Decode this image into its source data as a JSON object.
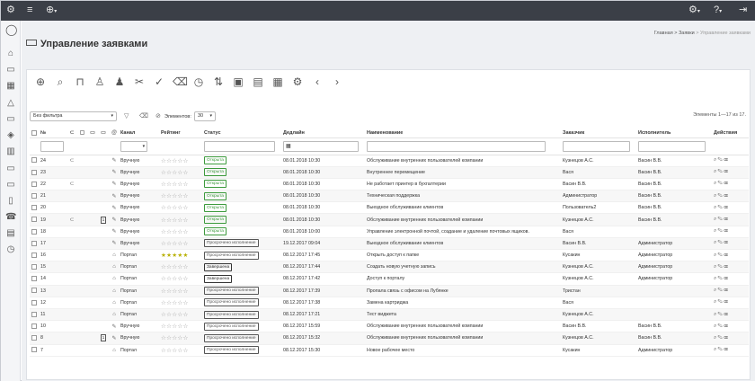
{
  "topbar": {
    "logo_icon": "gear-logo-icon",
    "menu_icon": "hamburger-icon",
    "add_icon": "plus-circle-icon",
    "right_icons": [
      "settings-icon",
      "help-icon",
      "logout-icon"
    ]
  },
  "sidebar": {
    "items": [
      "user-icon",
      "home-icon",
      "ticket-icon",
      "calendar-icon",
      "warning-icon",
      "box-icon",
      "layers-icon",
      "chart-icon",
      "monitor-icon",
      "laptop-icon",
      "phone-icon",
      "call-icon",
      "database-icon",
      "history-icon"
    ]
  },
  "header": {
    "title": "Управление заявками",
    "breadcrumb": {
      "home": "Главная",
      "sep1": "> Заявки",
      "current": "> Управление заявками"
    }
  },
  "toolbar": {
    "icons": [
      "add-icon",
      "search-icon",
      "bookmark-icon",
      "user-icon",
      "users-icon",
      "tools-icon",
      "check-icon",
      "trash-icon",
      "timer-icon",
      "sort-icon",
      "export-icon",
      "list-icon",
      "report-icon",
      "settings-icon",
      "prev-icon",
      "next-icon"
    ]
  },
  "filters": {
    "filter_select": "Без фильтра",
    "elements_label": "Элементов:",
    "page_size": "30",
    "count_text": "Элементы 1—17 из 17."
  },
  "table": {
    "headers": {
      "num": "№",
      "channel": "Канал",
      "rating": "Рейтинг",
      "status": "Статус",
      "deadline": "Дедлайн",
      "name": "Наименование",
      "customer": "Заказчик",
      "executor": "Исполнитель",
      "actions": "Действия"
    },
    "rows": [
      {
        "num": "24",
        "clip": true,
        "edit": "pencil",
        "channel": "Вручную",
        "stars": "☆☆☆☆☆",
        "gold": false,
        "status": "Открыта",
        "st": "open",
        "deadline": "08.01.2018 10:30",
        "name": "Обслуживание внутренних пользователей компании",
        "customer": "Кузнецов А.С.",
        "executor": "Васин В.В."
      },
      {
        "num": "23",
        "edit": "pencil",
        "channel": "Вручную",
        "stars": "☆☆☆☆☆",
        "gold": false,
        "status": "Открыта",
        "st": "open",
        "deadline": "08.01.2018 10:30",
        "name": "Внутреннее перемещение",
        "customer": "Вася",
        "executor": "Васин В.В."
      },
      {
        "num": "22",
        "clip": true,
        "edit": "pencil",
        "channel": "Вручную",
        "stars": "☆☆☆☆☆",
        "gold": false,
        "status": "Открыта",
        "st": "open",
        "deadline": "08.01.2018 10:30",
        "name": "Не работает принтер в бухгалтерии",
        "customer": "Васин В.В.",
        "executor": "Васин В.В."
      },
      {
        "num": "21",
        "edit": "pencil",
        "channel": "Вручную",
        "stars": "☆☆☆☆☆",
        "gold": false,
        "status": "Открыта",
        "st": "open",
        "deadline": "08.01.2018 10:30",
        "name": "Техническая поддержка",
        "customer": "Администратор",
        "executor": "Васин В.В."
      },
      {
        "num": "20",
        "edit": "pencil",
        "channel": "Вручную",
        "stars": "☆☆☆☆☆",
        "gold": false,
        "status": "Открыта",
        "st": "open",
        "deadline": "08.01.2018 10:30",
        "name": "Выездное обслуживание клиентов",
        "customer": "Пользователь2",
        "executor": "Васин В.В."
      },
      {
        "num": "19",
        "clip": true,
        "box": "1",
        "edit": "pencil",
        "channel": "Вручную",
        "stars": "☆☆☆☆☆",
        "gold": false,
        "status": "Открыта",
        "st": "open",
        "deadline": "08.01.2018 10:30",
        "name": "Обслуживание внутренних пользователей компании",
        "customer": "Кузнецов А.С.",
        "executor": "Васин В.В."
      },
      {
        "num": "18",
        "edit": "pencil",
        "channel": "Вручную",
        "stars": "☆☆☆☆☆",
        "gold": false,
        "status": "Открыта",
        "st": "open",
        "deadline": "08.01.2018 10:00",
        "name": "Управление электронной почтой, создание и удаление почтовых ящиков.",
        "customer": "Вася",
        "executor": ""
      },
      {
        "num": "17",
        "edit": "pencil",
        "channel": "Вручную",
        "stars": "☆☆☆☆☆",
        "gold": false,
        "status": "Просрочено исполнение",
        "st": "over",
        "deadline": "19.12.2017 09:04",
        "name": "Выездное обслуживание клиентов",
        "customer": "Васин В.В.",
        "executor": "Администратор"
      },
      {
        "num": "16",
        "edit": "house",
        "channel": "Портал",
        "stars": "★★★★★",
        "gold": true,
        "status": "Просрочено исполнение",
        "st": "over",
        "deadline": "08.12.2017 17:45",
        "name": "Открыть доступ к папке",
        "customer": "Кусакин",
        "executor": "Администратор"
      },
      {
        "num": "15",
        "edit": "house",
        "channel": "Портал",
        "stars": "☆☆☆☆☆",
        "gold": false,
        "status": "Завершена",
        "st": "done",
        "deadline": "08.12.2017 17:44",
        "name": "Создать новую учетную запись",
        "customer": "Кузнецов А.С.",
        "executor": "Администратор"
      },
      {
        "num": "14",
        "edit": "house",
        "channel": "Портал",
        "stars": "☆☆☆☆☆",
        "gold": false,
        "status": "Завершена",
        "st": "done",
        "deadline": "08.12.2017 17:42",
        "name": "Доступ к порталу",
        "customer": "Кузнецов А.С.",
        "executor": "Администратор"
      },
      {
        "num": "13",
        "edit": "house",
        "channel": "Портал",
        "stars": "☆☆☆☆☆",
        "gold": false,
        "status": "Просрочено исполнение",
        "st": "over",
        "deadline": "08.12.2017 17:39",
        "name": "Пропала связь с офисом на Лубянке",
        "customer": "Тристан",
        "executor": ""
      },
      {
        "num": "12",
        "edit": "house",
        "channel": "Портал",
        "stars": "☆☆☆☆☆",
        "gold": false,
        "status": "Просрочено исполнение",
        "st": "over",
        "deadline": "08.12.2017 17:38",
        "name": "Замена картриджа",
        "customer": "Вася",
        "executor": ""
      },
      {
        "num": "11",
        "edit": "house",
        "channel": "Портал",
        "stars": "☆☆☆☆☆",
        "gold": false,
        "status": "Просрочено исполнение",
        "st": "over",
        "deadline": "08.12.2017 17:21",
        "name": "Тест виджета",
        "customer": "Кузнецов А.С.",
        "executor": ""
      },
      {
        "num": "10",
        "edit": "pencil",
        "channel": "Вручную",
        "stars": "☆☆☆☆☆",
        "gold": false,
        "status": "Просрочено исполнение",
        "st": "over",
        "deadline": "08.12.2017 15:59",
        "name": "Обслуживание внутренних пользователей компании",
        "customer": "Васин В.В.",
        "executor": "Васин В.В."
      },
      {
        "num": "8",
        "box": "1",
        "edit": "pencil",
        "channel": "Вручную",
        "stars": "☆☆☆☆☆",
        "gold": false,
        "status": "Просрочено исполнение",
        "st": "over",
        "deadline": "08.12.2017 15:32",
        "name": "Обслуживание внутренних пользователей компании",
        "customer": "Кузнецов А.С.",
        "executor": "Васин В.В."
      },
      {
        "num": "7",
        "edit": "house",
        "channel": "Портал",
        "stars": "☆☆☆☆☆",
        "gold": false,
        "status": "Просрочено исполнение",
        "st": "over",
        "deadline": "08.12.2017 15:30",
        "name": "Новое рабочее место",
        "customer": "Кусакин",
        "executor": "Администратор"
      }
    ]
  }
}
